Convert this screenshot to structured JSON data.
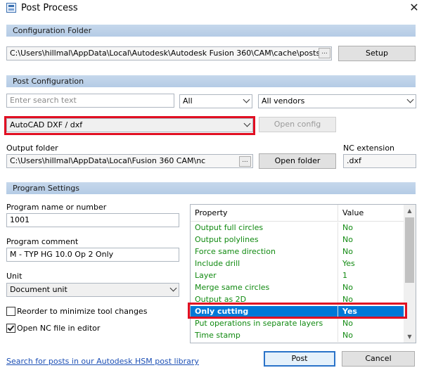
{
  "window": {
    "title": "Post Process",
    "close_glyph": "✕",
    "icon": "post-process-icon"
  },
  "config_folder": {
    "header": "Configuration Folder",
    "path": "C:\\Users\\hillmal\\AppData\\Local\\Autodesk\\Autodesk Fusion 360\\CAM\\cache\\posts",
    "browse_label": "...",
    "setup_label": "Setup"
  },
  "post_config": {
    "header": "Post Configuration",
    "search_placeholder": "Enter search text",
    "filter_all": "All",
    "filter_vendor": "All vendors",
    "post_selected": "AutoCAD DXF / dxf",
    "open_config_label": "Open config",
    "output_folder_label": "Output folder",
    "output_folder_path": "C:\\Users\\hillmal\\AppData\\Local\\Fusion 360 CAM\\nc",
    "browse_label": "...",
    "open_folder_label": "Open folder",
    "nc_extension_label": "NC extension",
    "nc_extension_value": ".dxf"
  },
  "program_settings": {
    "header": "Program Settings",
    "program_name_label": "Program name or number",
    "program_name_value": "1001",
    "program_comment_label": "Program comment",
    "program_comment_value": "M - TYP HG 10.0 Op 2 Only",
    "unit_label": "Unit",
    "unit_value": "Document unit",
    "reorder_label": "Reorder to minimize tool changes",
    "reorder_checked": false,
    "open_nc_label": "Open NC file in editor",
    "open_nc_checked": true
  },
  "property_grid": {
    "columns": [
      "Property",
      "Value"
    ],
    "rows": [
      {
        "property": "Output full circles",
        "value": "No"
      },
      {
        "property": "Output polylines",
        "value": "No"
      },
      {
        "property": "Force same direction",
        "value": "No"
      },
      {
        "property": "Include drill",
        "value": "Yes"
      },
      {
        "property": "Layer",
        "value": "1"
      },
      {
        "property": "Merge same circles",
        "value": "No"
      },
      {
        "property": "Output as 2D",
        "value": "No"
      },
      {
        "property": "Only cutting",
        "value": "Yes",
        "selected": true
      },
      {
        "property": "Put operations in separate layers",
        "value": "No"
      },
      {
        "property": "Time stamp",
        "value": "No"
      }
    ],
    "scroll_up": "▲",
    "scroll_down": "▼"
  },
  "footer": {
    "library_link": "Search for posts in our Autodesk HSM post library",
    "post_label": "Post",
    "cancel_label": "Cancel"
  },
  "colors": {
    "section_header": "#b4cbe5",
    "highlight": "#e10f22",
    "selection": "#0078d7",
    "property_text": "#118a11",
    "link": "#1c4fb5"
  }
}
